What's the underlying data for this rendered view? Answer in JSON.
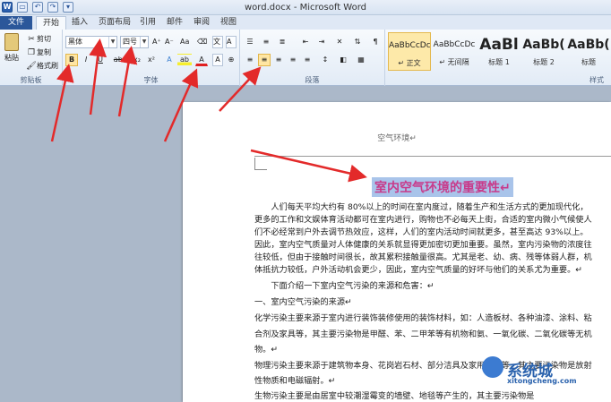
{
  "window": {
    "title": "word.docx - Microsoft Word"
  },
  "qat": {
    "word": "W",
    "save": "▭",
    "undo": "↶",
    "redo": "↷",
    "customize": "▾"
  },
  "tabs": [
    "文件",
    "开始",
    "插入",
    "页面布局",
    "引用",
    "邮件",
    "审阅",
    "视图"
  ],
  "clipboard": {
    "paste": "粘贴",
    "cut": "剪切",
    "copy": "复制",
    "format_painter": "格式刷",
    "label": "剪贴板"
  },
  "font": {
    "name": "黑体",
    "size": "四号",
    "grow": "A⁺",
    "shrink": "A⁻",
    "case": "Aa",
    "bold": "B",
    "italic": "I",
    "underline": "U",
    "strike": "abc",
    "sub": "x₂",
    "sup": "x²",
    "label": "字体"
  },
  "paragraph": {
    "label": "段落"
  },
  "styles": {
    "label": "样式",
    "items": [
      {
        "sample": "AaBbCcDc",
        "name": "↵ 正文"
      },
      {
        "sample": "AaBbCcDc",
        "name": "↵ 无间隔"
      },
      {
        "sample": "AaBl",
        "name": "标题 1"
      },
      {
        "sample": "AaBb(",
        "name": "标题 2"
      },
      {
        "sample": "AaBb(",
        "name": "标题"
      }
    ]
  },
  "document": {
    "header": "空气环境↵",
    "title": "室内空气环境的重要性↵",
    "lines": [
      "　　人们每天平均大约有 80%以上的时间在室内度过，随着生产和生活方式的更加现代化，",
      "更多的工作和文娱体育活动都可在室内进行，购物也不必每天上街，合适的室内微小气候使人",
      "们不必经常到户外去调节热效应，这样，人们的室内活动时间就更多，甚至高达 93%以上。",
      "因此，室内空气质量对人体健康的关系就显得更加密切更加重要。虽然，室内污染物的浓度往",
      "往较低，但由于接触时间很长，故其累积接触量很高。尤其是老、幼、病、残等体弱人群，机",
      "体抵抗力较低，户外活动机会更少，因此，室内空气质量的好坏与他们的关系尤为重要。↵",
      "　　下面介绍一下室内空气污染的来源和危害：↵",
      "一、室内空气污染的来源↵",
      "化学污染主要来源于室内进行装饰装修使用的装饰材料，如：人造板材、各种油漆、涂料、粘",
      "合剂及家具等，其主要污染物是甲醛、苯、二甲苯等有机物和氨、一氧化碳、二氧化碳等无机",
      "物。↵",
      "物理污染主要来源于建筑物本身、花岗岩石材、部分洁具及家用电器等，其主要污染物是放射",
      "性物质和电磁辐射。↵",
      "生物污染主要是由居室中较潮湿霉变的墙壁、地毯等产生的，其主要污染物是"
    ]
  },
  "watermark": {
    "brand": "系统城",
    "url": "xitongcheng.com"
  },
  "colors": {
    "accent": "#2b579a",
    "title_text": "#c83a8a",
    "highlight": "#a9c4ea",
    "arrow": "#e32a2a"
  }
}
